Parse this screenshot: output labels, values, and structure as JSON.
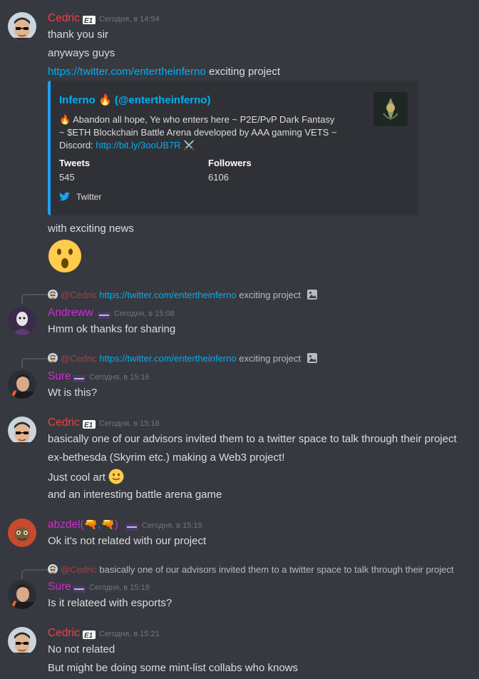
{
  "colors": {
    "cedric": "#ed4245",
    "purple": "#d02cd2",
    "link": "#00aff4",
    "twitter": "#1da1f2",
    "bg": "#36393f"
  },
  "messages": {
    "m1": {
      "author": "Cedric",
      "badge": "E1",
      "time": "Сегодня, в 14:54",
      "lines": [
        "thank you sir",
        "anyways guys"
      ],
      "link": "https://twitter.com/entertheinferno",
      "link_suffix": " exciting project",
      "embed": {
        "author": "Inferno 🔥 (@entertheinferno)",
        "desc_prefix": "🔥 Abandon all hope, Ye who enters here ~ P2E/PvP Dark Fantasy ~ $ETH Blockchain Battle Arena developed by AAA gaming VETS ~ Discord: ",
        "desc_link": "http://bit.ly/3ooUB7R",
        "desc_suffix": " ⚔️",
        "field1_name": "Tweets",
        "field1_value": "545",
        "field2_name": "Followers",
        "field2_value": "6106",
        "footer": "Twitter"
      },
      "after": "with exciting news",
      "emoji": "😮"
    },
    "m2": {
      "reply_mention": "@Cedric",
      "reply_link": "https://twitter.com/entertheinferno",
      "reply_text": " exciting project",
      "author": "Andreww",
      "time": "Сегодня, в 15:08",
      "text": "Hmm ok thanks for sharing"
    },
    "m3": {
      "reply_mention": "@Cedric",
      "reply_link": "https://twitter.com/entertheinferno",
      "reply_text": " exciting project",
      "author": "Sure",
      "time": "Сегодня, в 15:16",
      "text": "Wt is this?"
    },
    "m4": {
      "author": "Cedric",
      "badge": "E1",
      "time": "Сегодня, в 15:16",
      "lines": [
        "basically one of our advisors invited them to a twitter space to talk through their project",
        "ex-bethesda (Skyrim etc.) making a Web3 project!",
        "Just cool art",
        "and an interesting battle arena game"
      ],
      "emoji": "🙂"
    },
    "m5": {
      "author": "abzdel(🔫,🔫)",
      "time": "Сегодня, в 15:19",
      "text": "Ok it's not related with our project"
    },
    "m6": {
      "reply_mention": "@Cedric",
      "reply_text": " basically one of our advisors invited them to a twitter space to talk through their project",
      "author": "Sure",
      "time": "Сегодня, в 15:19",
      "text": "Is it relateed with esports?"
    },
    "m7": {
      "author": "Cedric",
      "badge": "E1",
      "time": "Сегодня, в 15:21",
      "lines": [
        "No not related",
        "But might be doing some mint-list collabs who knows"
      ]
    }
  }
}
